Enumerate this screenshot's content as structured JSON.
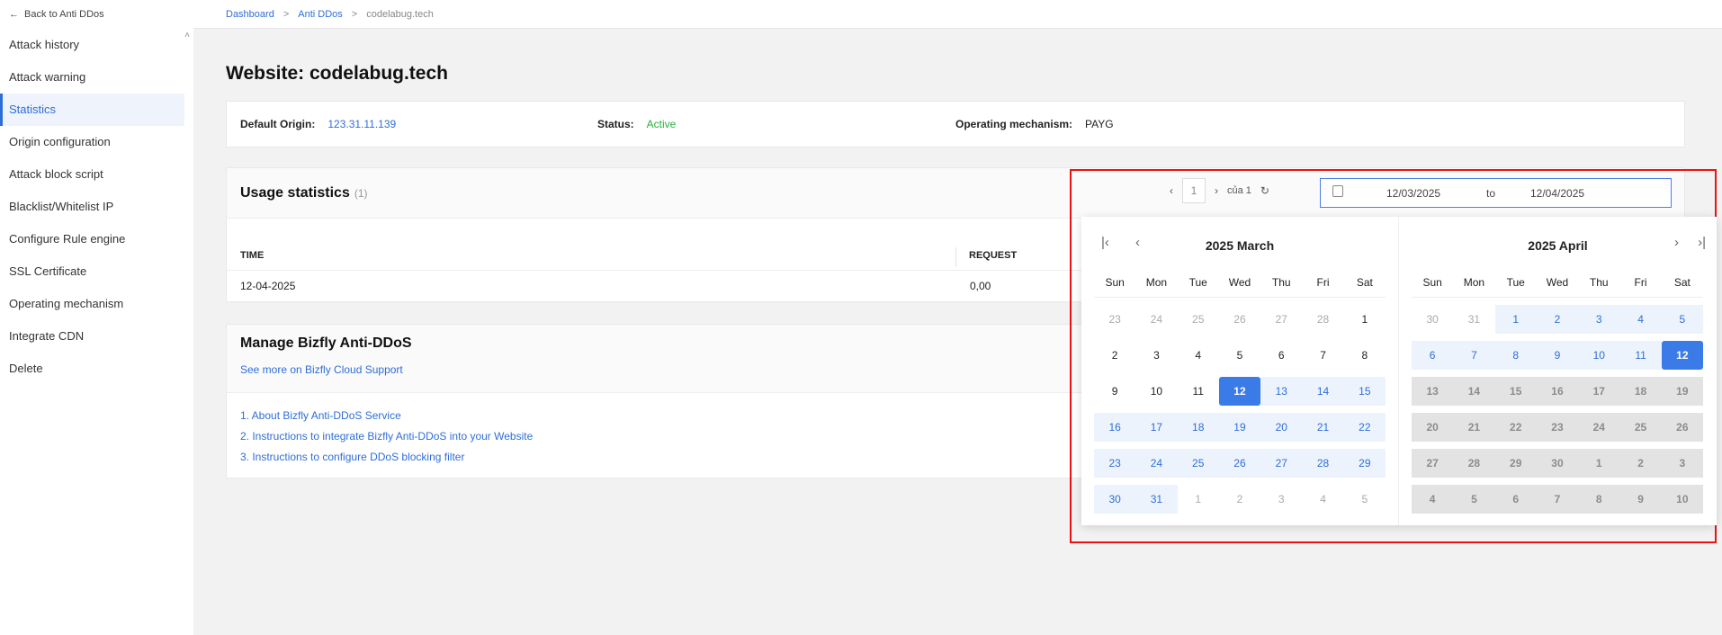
{
  "sidebar": {
    "back_label": "Back to Anti DDos",
    "items": [
      {
        "label": "Attack history"
      },
      {
        "label": "Attack warning"
      },
      {
        "label": "Statistics"
      },
      {
        "label": "Origin configuration"
      },
      {
        "label": "Attack block script"
      },
      {
        "label": "Blacklist/Whitelist IP"
      },
      {
        "label": "Configure Rule engine"
      },
      {
        "label": "SSL Certificate"
      },
      {
        "label": "Operating mechanism"
      },
      {
        "label": "Integrate CDN"
      },
      {
        "label": "Delete"
      }
    ],
    "active_index": 2
  },
  "breadcrumb": {
    "items": [
      "Dashboard",
      "Anti DDos",
      "codelabug.tech"
    ],
    "separator": ">"
  },
  "page_title": "Website: codelabug.tech",
  "info": {
    "origin_label": "Default Origin:",
    "origin_value": "123.31.11.139",
    "status_label": "Status:",
    "status_value": "Active",
    "mechanism_label": "Operating mechanism:",
    "mechanism_value": "PAYG"
  },
  "usage": {
    "title": "Usage statistics",
    "count": "(1)",
    "columns": [
      "TIME",
      "REQUEST"
    ],
    "rows": [
      [
        "12-04-2025",
        "0,00"
      ]
    ]
  },
  "pager": {
    "prev": "‹",
    "page": "1",
    "next": "›",
    "of_label": "của 1",
    "refresh_icon": "↻"
  },
  "date_range": {
    "start": "12/03/2025",
    "sep": "to",
    "end": "12/04/2025"
  },
  "calendar": {
    "weekdays": [
      "Sun",
      "Mon",
      "Tue",
      "Wed",
      "Thu",
      "Fri",
      "Sat"
    ],
    "nav": {
      "first": "|‹",
      "prev": "‹",
      "next": "›",
      "last": "›|"
    },
    "months": [
      {
        "title": "2025 March",
        "weeks": [
          [
            {
              "d": "23",
              "s": "other"
            },
            {
              "d": "24",
              "s": "other"
            },
            {
              "d": "25",
              "s": "other"
            },
            {
              "d": "26",
              "s": "other"
            },
            {
              "d": "27",
              "s": "other"
            },
            {
              "d": "28",
              "s": "other"
            },
            {
              "d": "1",
              "s": ""
            }
          ],
          [
            {
              "d": "2",
              "s": ""
            },
            {
              "d": "3",
              "s": ""
            },
            {
              "d": "4",
              "s": ""
            },
            {
              "d": "5",
              "s": ""
            },
            {
              "d": "6",
              "s": ""
            },
            {
              "d": "7",
              "s": ""
            },
            {
              "d": "8",
              "s": ""
            }
          ],
          [
            {
              "d": "9",
              "s": ""
            },
            {
              "d": "10",
              "s": ""
            },
            {
              "d": "11",
              "s": ""
            },
            {
              "d": "12",
              "s": "sel"
            },
            {
              "d": "13",
              "s": "range"
            },
            {
              "d": "14",
              "s": "range"
            },
            {
              "d": "15",
              "s": "range"
            }
          ],
          [
            {
              "d": "16",
              "s": "range"
            },
            {
              "d": "17",
              "s": "range"
            },
            {
              "d": "18",
              "s": "range"
            },
            {
              "d": "19",
              "s": "range"
            },
            {
              "d": "20",
              "s": "range"
            },
            {
              "d": "21",
              "s": "range"
            },
            {
              "d": "22",
              "s": "range"
            }
          ],
          [
            {
              "d": "23",
              "s": "range"
            },
            {
              "d": "24",
              "s": "range"
            },
            {
              "d": "25",
              "s": "range"
            },
            {
              "d": "26",
              "s": "range"
            },
            {
              "d": "27",
              "s": "range"
            },
            {
              "d": "28",
              "s": "range"
            },
            {
              "d": "29",
              "s": "range"
            }
          ],
          [
            {
              "d": "30",
              "s": "range"
            },
            {
              "d": "31",
              "s": "range"
            },
            {
              "d": "1",
              "s": "other"
            },
            {
              "d": "2",
              "s": "other"
            },
            {
              "d": "3",
              "s": "other"
            },
            {
              "d": "4",
              "s": "other"
            },
            {
              "d": "5",
              "s": "other"
            }
          ]
        ]
      },
      {
        "title": "2025 April",
        "weeks": [
          [
            {
              "d": "30",
              "s": "other"
            },
            {
              "d": "31",
              "s": "other"
            },
            {
              "d": "1",
              "s": "range"
            },
            {
              "d": "2",
              "s": "range"
            },
            {
              "d": "3",
              "s": "range"
            },
            {
              "d": "4",
              "s": "range"
            },
            {
              "d": "5",
              "s": "range"
            }
          ],
          [
            {
              "d": "6",
              "s": "range"
            },
            {
              "d": "7",
              "s": "range"
            },
            {
              "d": "8",
              "s": "range"
            },
            {
              "d": "9",
              "s": "range"
            },
            {
              "d": "10",
              "s": "range"
            },
            {
              "d": "11",
              "s": "range"
            },
            {
              "d": "12",
              "s": "sel"
            }
          ],
          [
            {
              "d": "13",
              "s": "dis"
            },
            {
              "d": "14",
              "s": "dis"
            },
            {
              "d": "15",
              "s": "dis"
            },
            {
              "d": "16",
              "s": "dis"
            },
            {
              "d": "17",
              "s": "dis"
            },
            {
              "d": "18",
              "s": "dis"
            },
            {
              "d": "19",
              "s": "dis"
            }
          ],
          [
            {
              "d": "20",
              "s": "dis"
            },
            {
              "d": "21",
              "s": "dis"
            },
            {
              "d": "22",
              "s": "dis"
            },
            {
              "d": "23",
              "s": "dis"
            },
            {
              "d": "24",
              "s": "dis"
            },
            {
              "d": "25",
              "s": "dis"
            },
            {
              "d": "26",
              "s": "dis"
            }
          ],
          [
            {
              "d": "27",
              "s": "dis"
            },
            {
              "d": "28",
              "s": "dis"
            },
            {
              "d": "29",
              "s": "dis"
            },
            {
              "d": "30",
              "s": "dis"
            },
            {
              "d": "1",
              "s": "dis"
            },
            {
              "d": "2",
              "s": "dis"
            },
            {
              "d": "3",
              "s": "dis"
            }
          ],
          [
            {
              "d": "4",
              "s": "dis"
            },
            {
              "d": "5",
              "s": "dis"
            },
            {
              "d": "6",
              "s": "dis"
            },
            {
              "d": "7",
              "s": "dis"
            },
            {
              "d": "8",
              "s": "dis"
            },
            {
              "d": "9",
              "s": "dis"
            },
            {
              "d": "10",
              "s": "dis"
            }
          ]
        ]
      }
    ]
  },
  "manage": {
    "title": "Manage Bizfly Anti-DDoS",
    "support_link": "See more on Bizfly Cloud Support",
    "links": [
      "1. About Bizfly Anti-DDoS Service",
      "2. Instructions to integrate Bizfly Anti-DDoS into your Website",
      "3. Instructions to configure DDoS blocking filter"
    ]
  },
  "colors": {
    "accent": "#2f6ed8",
    "status_active": "#22b33a",
    "highlight_border": "#e11111",
    "selected_day": "#3b7be8"
  }
}
